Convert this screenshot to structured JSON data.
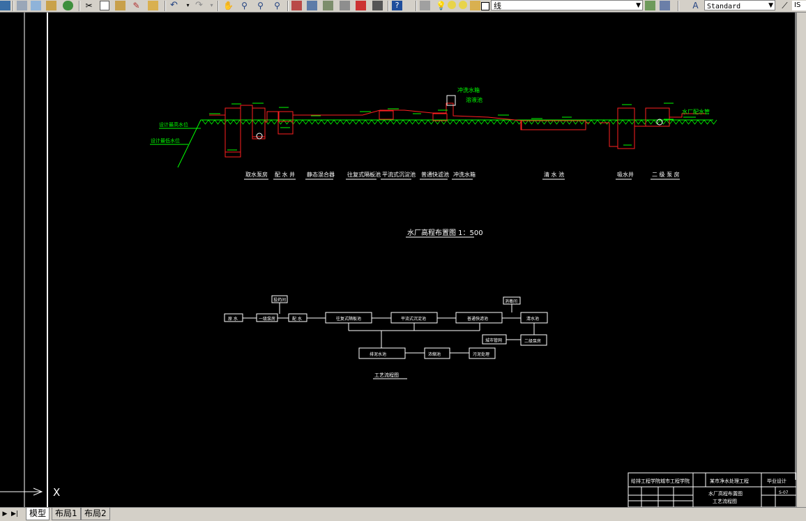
{
  "toolbar": {
    "layer_name": "线",
    "text_style": "Standard",
    "right_cut_label": "IS"
  },
  "tabs": [
    {
      "label": "模型",
      "active": true
    },
    {
      "label": "布局1",
      "active": false
    },
    {
      "label": "布局2",
      "active": false
    }
  ],
  "drawing": {
    "profile_labels": [
      "取水泵房",
      "配 水 井",
      "静态混合器",
      "往复式隔板池",
      "平流式沉淀池",
      "普通快滤池",
      "冲洗水箱",
      "清 水 池",
      "吸水井",
      "二 级 泵 房"
    ],
    "profile_callouts": [
      "冲洗水箱",
      "溶液池",
      "水厂配水管",
      "设计最高水位",
      "设计最低水位"
    ],
    "profile_title": "水厂高程布置图 1：500",
    "flow_boxes": [
      "原 水",
      "一级泵房",
      "配 水",
      "往复式隔板池",
      "平流式沉淀池",
      "普通快滤池",
      "清水池",
      "二级泵房",
      "城市管网",
      "排泥水池",
      "浓缩池",
      "污泥处理"
    ],
    "flow_dosing": [
      "投药间",
      "消毒间"
    ],
    "flow_title": "工艺流程图",
    "title_block": {
      "school": "给排工程学院城市工程学院",
      "project": "某市净水处理工程",
      "drawing_name_1": "水厂高程布置图",
      "drawing_name_2": "工艺流程图",
      "stage": "毕业设计",
      "sheet_no": "S-07"
    },
    "ucs_label": "X"
  },
  "colors": {
    "canvas": "#000000",
    "lines": "#ffffff",
    "green": "#00ff00",
    "red": "#ff0000",
    "yellow": "#ffff00",
    "chrome": "#d4d0c8"
  }
}
